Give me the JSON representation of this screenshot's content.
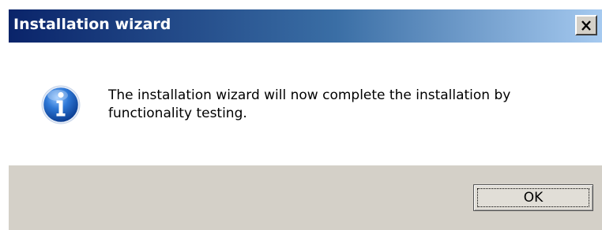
{
  "window": {
    "title": "Installation wizard",
    "close_icon": "close-x-icon"
  },
  "dialog": {
    "icon": "information-icon",
    "message": "The installation wizard will now complete the installation by functionality testing."
  },
  "buttons": {
    "ok_label": "OK"
  },
  "colors": {
    "titlebar_start": "#0a246a",
    "titlebar_end": "#a6caf0",
    "dialog_face": "#d4d0c8",
    "icon_blue": "#1f5fbf"
  }
}
